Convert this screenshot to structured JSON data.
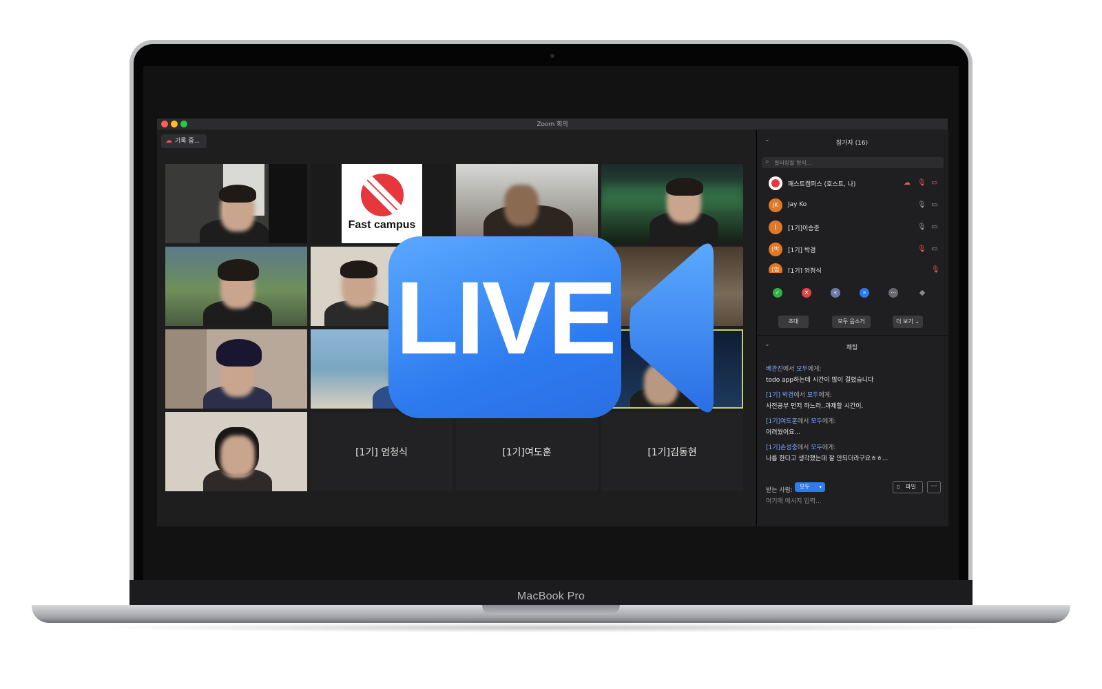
{
  "laptop": {
    "brand": "MacBook Pro"
  },
  "window": {
    "title": "Zoom 회의",
    "record_label": "기록 중..."
  },
  "tiles": [
    {
      "kind": "video"
    },
    {
      "kind": "logo",
      "logo_text": "Fast campus"
    },
    {
      "kind": "video"
    },
    {
      "kind": "video"
    },
    {
      "kind": "video"
    },
    {
      "kind": "video"
    },
    {
      "kind": "video"
    },
    {
      "kind": "video"
    },
    {
      "kind": "video"
    },
    {
      "kind": "video"
    },
    {
      "kind": "video"
    },
    {
      "kind": "video"
    },
    {
      "kind": "video"
    },
    {
      "kind": "name",
      "name": "[1기] 엄청식"
    },
    {
      "kind": "name",
      "name": "[1기]여도훈"
    },
    {
      "kind": "name",
      "name": "[1기]김동현"
    }
  ],
  "participants": {
    "header": "참가자 (16)",
    "filter_placeholder": "필터링할 형식...",
    "list": [
      {
        "initials": "",
        "name": "패스트캠퍼스 (호스트, 나)",
        "mic": "muted",
        "video": "off"
      },
      {
        "initials": "JK",
        "name": "Jay Ko",
        "mic": "on",
        "video": "on"
      },
      {
        "initials": "[",
        "name": "[1기]이승준",
        "mic": "on",
        "video": "on"
      },
      {
        "initials": "[박",
        "name": "[1기] 박겸",
        "mic": "muted",
        "video": "on"
      },
      {
        "initials": "[엄",
        "name": "[1기] 엄청식",
        "mic": "muted",
        "video": "none"
      }
    ],
    "buttons": {
      "invite": "초대",
      "mute_all": "모두 음소거",
      "more": "더 보기"
    }
  },
  "chat": {
    "header": "채팅",
    "from_word": "에서",
    "to_word": "모두",
    "to_suffix": "에게:",
    "messages": [
      {
        "sender": "배관진",
        "text": "todo app하는데 시간이 많이 걸렸습니다"
      },
      {
        "sender": "[1기] 박겸",
        "text": "사전공부 먼저 하느라..과제할 시간이."
      },
      {
        "sender": "[1기]여도훈",
        "text": "어려웠어요..."
      },
      {
        "sender": "[1기]손성중",
        "text": "나름 한다고 생각했는데 잘 안되더라구요ㅎㅎ..."
      }
    ],
    "recipient_label": "받는 사람:",
    "recipient_value": "모두",
    "file_label": "파일",
    "input_placeholder": "여기에 메시지 입력..."
  },
  "overlay": {
    "text": "LIVE"
  },
  "colors": {
    "accent": "#2d7bef",
    "link": "#7aa6ff",
    "tl_red": "#fe5f57",
    "tl_yellow": "#febc2e",
    "tl_green": "#28c840"
  }
}
